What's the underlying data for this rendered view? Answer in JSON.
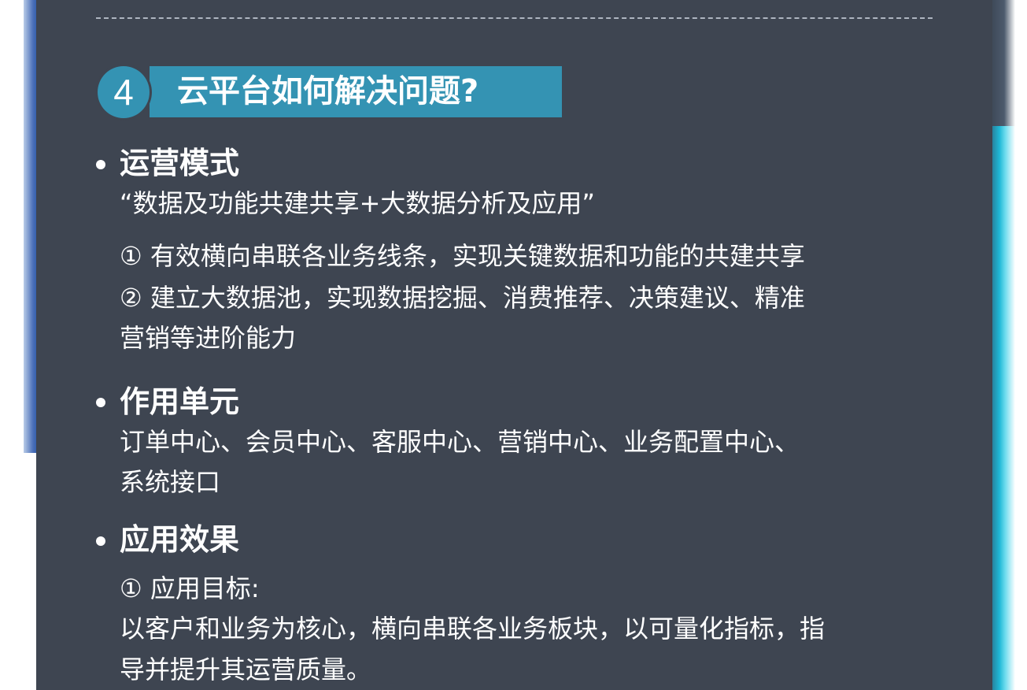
{
  "section": {
    "number": "4",
    "title": "云平台如何解决问题?"
  },
  "blocks": [
    {
      "heading": "运营模式",
      "lines": [
        "“数据及功能共建共享+大数据分析及应用”",
        "① 有效横向串联各业务线条，实现关键数据和功能的共建共享",
        "② 建立大数据池，实现数据挖掘、消费推荐、决策建议、精准",
        "营销等进阶能力"
      ]
    },
    {
      "heading": "作用单元",
      "lines": [
        "订单中心、会员中心、客服中心、营销中心、业务配置中心、",
        "系统接口"
      ]
    },
    {
      "heading": "应用效果",
      "lines": [
        "① 应用目标:",
        "以客户和业务为核心，横向串联各业务板块，以可量化指标，指",
        "导并提升其运营质量。"
      ]
    }
  ],
  "colors": {
    "panel": "#3e4551",
    "accent": "#3493b3",
    "text": "#ffffff"
  }
}
